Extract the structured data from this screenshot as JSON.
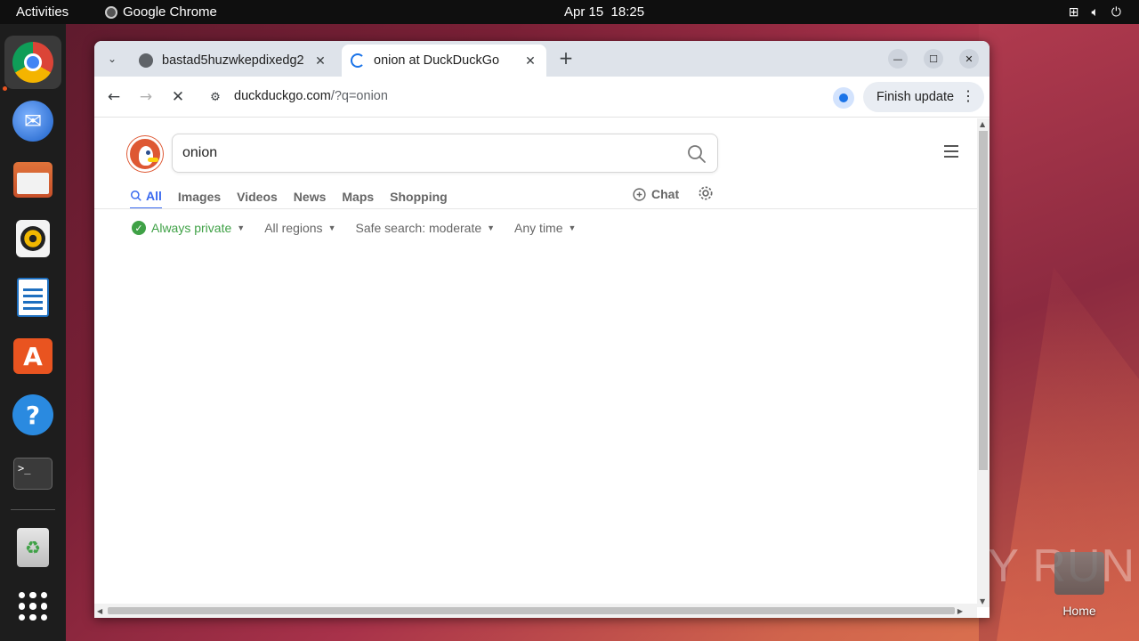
{
  "topbar": {
    "activities": "Activities",
    "app_name": "Google Chrome",
    "date": "Apr 15",
    "time": "18:25"
  },
  "dock": {
    "items": [
      "chrome-icon",
      "thunderbird-icon",
      "files-icon",
      "rhythmbox-icon",
      "writer-icon",
      "app-center-icon",
      "help-icon",
      "terminal-icon",
      "trash-icon",
      "show-apps-icon"
    ]
  },
  "chrome": {
    "tabs": [
      {
        "title": "bastad5huzwkepdixedg2",
        "active": false
      },
      {
        "title": "onion at DuckDuckGo",
        "active": true
      }
    ],
    "url_host": "duckduckgo.com",
    "url_rest": "/?q=onion",
    "finish_update": "Finish update"
  },
  "ddg": {
    "query": "onion",
    "tabs": [
      "All",
      "Images",
      "Videos",
      "News",
      "Maps",
      "Shopping"
    ],
    "chat": "Chat",
    "filters": {
      "private": "Always private",
      "region": "All regions",
      "safe": "Safe search: moderate",
      "time": "Any time"
    }
  },
  "desktop": {
    "home_label": "Home",
    "watermark": "ANY RUN"
  },
  "colors": {
    "ddg_accent": "#3969ef",
    "private_green": "#3fa146",
    "ubuntu_orange": "#e95420"
  }
}
